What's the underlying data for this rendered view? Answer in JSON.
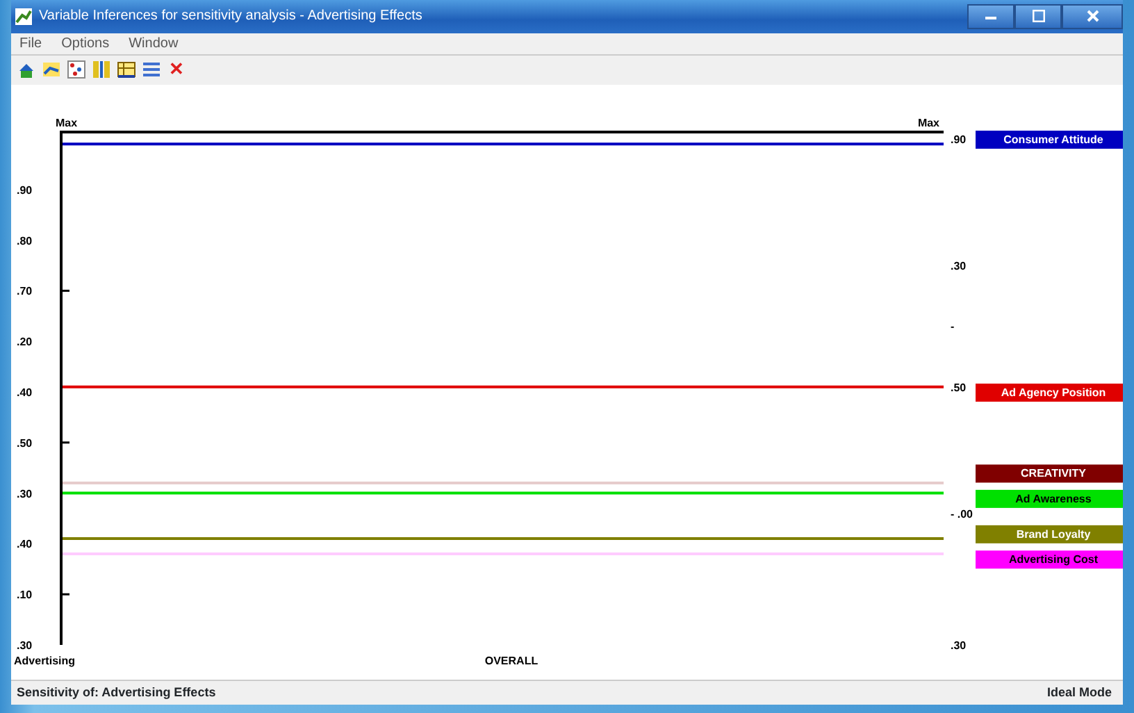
{
  "window": {
    "title": "Variable Inferences for sensitivity analysis - Advertising Effects"
  },
  "menu": [
    "File",
    "Options",
    "Window"
  ],
  "toolbar": {
    "close_glyph": "✕"
  },
  "chart": {
    "top_label": "Max",
    "top_right_label": "Max",
    "bottom_left_label": "Advertising",
    "center_label": "OVERALL",
    "left_axis_labels": [
      ".90",
      ".80",
      ".70",
      ".20",
      ".40",
      ".50",
      ".30",
      ".40",
      ".10",
      ".30"
    ],
    "right_axis_labels": [
      ".90",
      ".30",
      "-",
      ".50",
      "- .00",
      ".30"
    ],
    "legend": [
      {
        "label": "Consumer Attitude",
        "color": "#0000c0"
      },
      {
        "label": "Ad Agency Position",
        "color": "#e00000"
      },
      {
        "label": "CREATIVITY",
        "color": "#800000"
      },
      {
        "label": "Ad Awareness",
        "color": "#00e000"
      },
      {
        "label": "Brand Loyalty",
        "color": "#808000"
      },
      {
        "label": "Advertising Cost",
        "color": "#ff00ff"
      }
    ]
  },
  "status_bar": {
    "left": "Sensitivity of: Advertising Effects",
    "right": "Ideal Mode"
  }
}
